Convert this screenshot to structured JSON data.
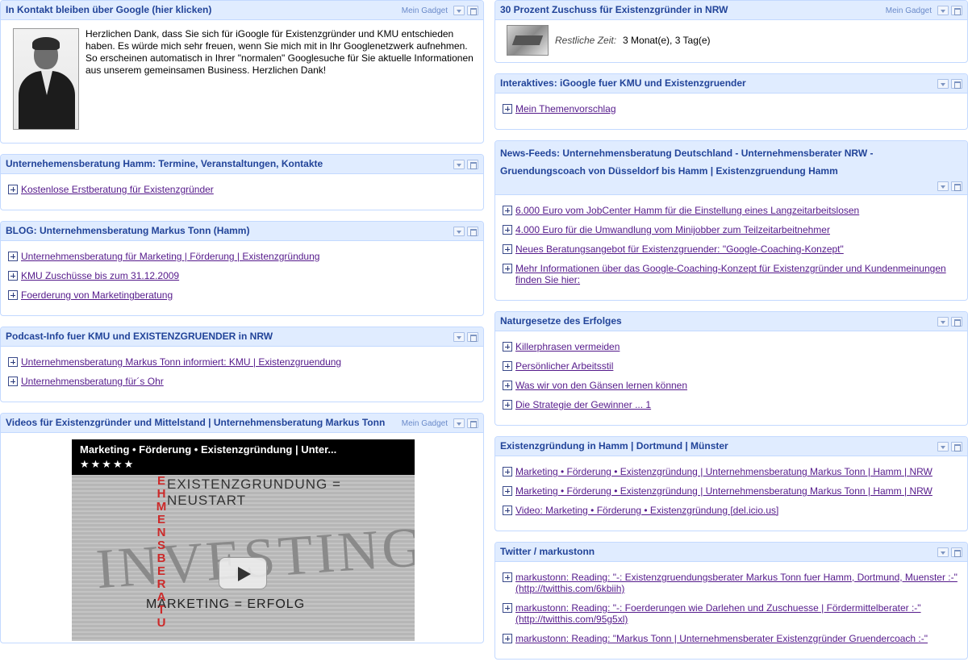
{
  "mein_gadget": "Mein Gadget",
  "left": {
    "contact": {
      "title": "In Kontakt bleiben über Google (hier klicken)",
      "text": "Herzlichen Dank, dass Sie sich für iGoogle für Existenzgründer und KMU entschieden haben. Es würde mich sehr freuen, wenn Sie mich mit in Ihr Googlenetzwerk aufnehmen. So erscheinen automatisch in Ihrer \"normalen\" Googlesuche für Sie aktuelle Informationen aus unserem gemeinsamen Business. Herzlichen Dank!"
    },
    "termine": {
      "title": "Unternehemensberatung Hamm: Termine, Veranstaltungen, Kontakte",
      "links": [
        "Kostenlose Erstberatung für Existenzgründer"
      ]
    },
    "blog": {
      "title": "BLOG: Unternehmensberatung Markus Tonn (Hamm)",
      "links": [
        "Unternehmensberatung für Marketing | Förderung | Existenzgründung",
        "KMU Zuschüsse bis zum 31.12.2009",
        "Foerderung von Marketingberatung"
      ]
    },
    "podcast": {
      "title": "Podcast-Info fuer KMU und EXISTENZGRUENDER in NRW",
      "links": [
        "Unternehmensberatung Markus Tonn informiert: KMU | Existenzgruendung",
        "Unternehmensberatung für´s Ohr"
      ]
    },
    "videos": {
      "title": "Videos für Existenzgründer und Mittelstand | Unternehmensberatung Markus Tonn",
      "video_title": "Marketing • Förderung • Existenzgründung | Unter...",
      "video_stars": "★★★★★",
      "overlay_line1": "EXISTENZGRUNDUNG = NEUSTART",
      "overlay_big": "INVESTING",
      "overlay_vertical": "EHMENSBERATU",
      "overlay_line2": "MARKETING = ERFOLG"
    }
  },
  "right": {
    "zuschuss": {
      "title": "30 Prozent Zuschuss für Existenzgründer in NRW",
      "label": "Restliche Zeit:",
      "value": "3 Monat(e), 3 Tag(e)"
    },
    "interaktiv": {
      "title": "Interaktives: iGoogle fuer KMU und Existenzgruender",
      "links": [
        "Mein Themenvorschlag"
      ]
    },
    "news": {
      "title": "News-Feeds: Unternehmensberatung Deutschland - Unternehmensberater NRW - Gruendungscoach von Düsseldorf bis Hamm | Existenzgruendung Hamm",
      "links": [
        "6.000 Euro vom JobCenter Hamm für die Einstellung eines Langzeitarbeitslosen",
        "4.000 Euro für die Umwandlung vom Minijobber zum Teilzeitarbeitnehmer",
        "Neues Beratungsangebot für Existenzgruender: \"Google-Coaching-Konzept\"",
        "Mehr Informationen über das Google-Coaching-Konzept für Existenzgründer und Kundenmeinungen finden Sie hier:"
      ]
    },
    "natur": {
      "title": "Naturgesetze des Erfolges",
      "links": [
        "Killerphrasen vermeiden",
        "Persönlicher Arbeitsstil",
        "Was wir von den Gänsen lernen können",
        "Die Strategie der Gewinner ... 1"
      ]
    },
    "hamm": {
      "title": "Existenzgründung in Hamm | Dortmund | Münster",
      "links": [
        "Marketing • Förderung • Existenzgründung | Unternehmensberatung Markus Tonn | Hamm | NRW",
        "Marketing • Förderung • Existenzgründung | Unternehmensberatung Markus Tonn | Hamm | NRW",
        "Video: Marketing • Förderung • Existenzgründung [del.icio.us]"
      ]
    },
    "twitter": {
      "title": "Twitter / markustonn",
      "links": [
        "markustonn: Reading: \"-: Existenzgruendungsberater Markus Tonn fuer Hamm, Dortmund, Muenster :-\" (http://twitthis.com/6kbiih)",
        "markustonn: Reading: \"-: Foerderungen wie Darlehen und Zuschuesse | Fördermittelberater :-\" (http://twitthis.com/95g5xl)",
        "markustonn: Reading: \"Markus Tonn | Unternehmensberater Existenzgründer Gruendercoach :-\""
      ]
    }
  }
}
